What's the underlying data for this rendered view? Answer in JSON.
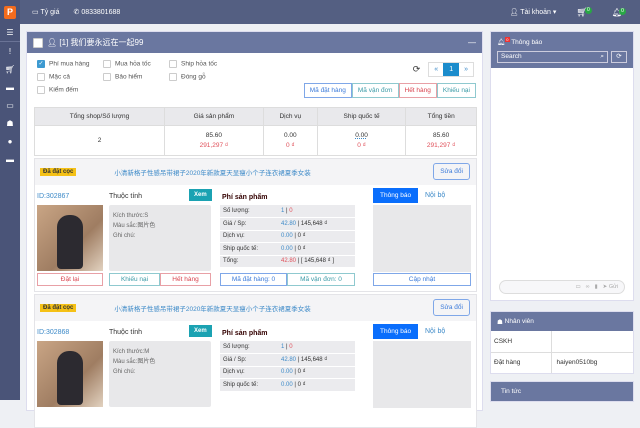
{
  "topbar": {
    "rate": "Tỷ giá",
    "phone": "0833801688",
    "account": "Tài khoản",
    "cart_count": "0",
    "bell_count": "0"
  },
  "panel": {
    "title": "[1] 我们要永远在一起99",
    "collapse": "—"
  },
  "options": [
    {
      "label": "Phí mua hàng",
      "checked": true
    },
    {
      "label": "Mua hỏa tốc",
      "checked": false
    },
    {
      "label": "Ship hỏa tốc",
      "checked": false
    },
    {
      "label": "Mặc cả",
      "checked": false
    },
    {
      "label": "Bảo hiểm",
      "checked": false
    },
    {
      "label": "Đóng gỗ",
      "checked": false
    },
    {
      "label": "Kiểm đếm",
      "checked": false
    }
  ],
  "pager": {
    "prev": "«",
    "current": "1",
    "next": "»"
  },
  "filters": [
    "Mã đặt hàng",
    "Mã vận đơn",
    "Hết hàng",
    "Khiếu nại"
  ],
  "summary": {
    "headers": [
      "Tổng shop/Số lượng",
      "Giá sản phẩm",
      "Dịch vụ",
      "Ship quốc tế",
      "Tổng tiền"
    ],
    "row": {
      "count": "2",
      "price": "85.60",
      "price_vnd": "291,297 ₫",
      "service": "0.00",
      "service_vnd": "0 ₫",
      "ship": "0.00",
      "ship_vnd": "0 ₫",
      "total": "85.60",
      "total_vnd": "291,297 ₫"
    }
  },
  "items": [
    {
      "status": "Đã đặt cọc",
      "title": "小清新格子性感吊带裙子2020年新款夏天显瘦小个子连衣裙夏季女装",
      "edit": "Sửa đổi",
      "id": "ID:302867",
      "attr_label": "Thuộc tính",
      "view": "Xem",
      "attrs": [
        "Kích thước:S",
        "Màu sắc:图片色",
        "Ghi chú:"
      ],
      "fee_title": "Phí sản phẩm",
      "fees": [
        {
          "label": "Số lượng:",
          "a": "1",
          "b": "0"
        },
        {
          "label": "Giá / Sp:",
          "a": "42.80",
          "b": "145,648 ₫"
        },
        {
          "label": "Dịch vụ:",
          "a": "0.00",
          "b": "0 ₫"
        },
        {
          "label": "Ship quốc tế:",
          "a": "0.00",
          "b": "0 ₫"
        },
        {
          "label": "Tổng:",
          "a": "42.80",
          "b": "[ 145,648 ₫ ]"
        }
      ],
      "tabs": [
        "Thông báo",
        "Nội bộ"
      ],
      "buttons": [
        "Đặt lại",
        "Khiếu nại",
        "Hết hàng",
        "Mã đặt hàng: 0",
        "Mã vận đơn: 0",
        "Cập nhật"
      ]
    },
    {
      "status": "Đã đặt cọc",
      "title": "小清新格子性感吊带裙子2020年新款夏天显瘦小个子连衣裙夏季女装",
      "edit": "Sửa đổi",
      "id": "ID:302868",
      "attr_label": "Thuộc tính",
      "view": "Xem",
      "attrs": [
        "Kích thước:M",
        "Màu sắc:图片色",
        "Ghi chú:"
      ],
      "fee_title": "Phí sản phẩm",
      "fees": [
        {
          "label": "Số lượng:",
          "a": "1",
          "b": "0"
        },
        {
          "label": "Giá / Sp:",
          "a": "42.80",
          "b": "145,648 ₫"
        },
        {
          "label": "Dịch vụ:",
          "a": "0.00",
          "b": "0 ₫"
        },
        {
          "label": "Ship quốc tế:",
          "a": "0.00",
          "b": "0 ₫"
        }
      ],
      "tabs": [
        "Thông báo",
        "Nội bộ"
      ]
    }
  ],
  "notify": {
    "title": "Thông báo",
    "badge": "0",
    "search_placeholder": "Search",
    "send": "Gửi"
  },
  "staff": {
    "title": "Nhân viên",
    "rows": [
      [
        "CSKH",
        ""
      ],
      [
        "Đặt hàng",
        "haiyen0510bg"
      ]
    ]
  },
  "news": {
    "title": "Tin tức"
  }
}
